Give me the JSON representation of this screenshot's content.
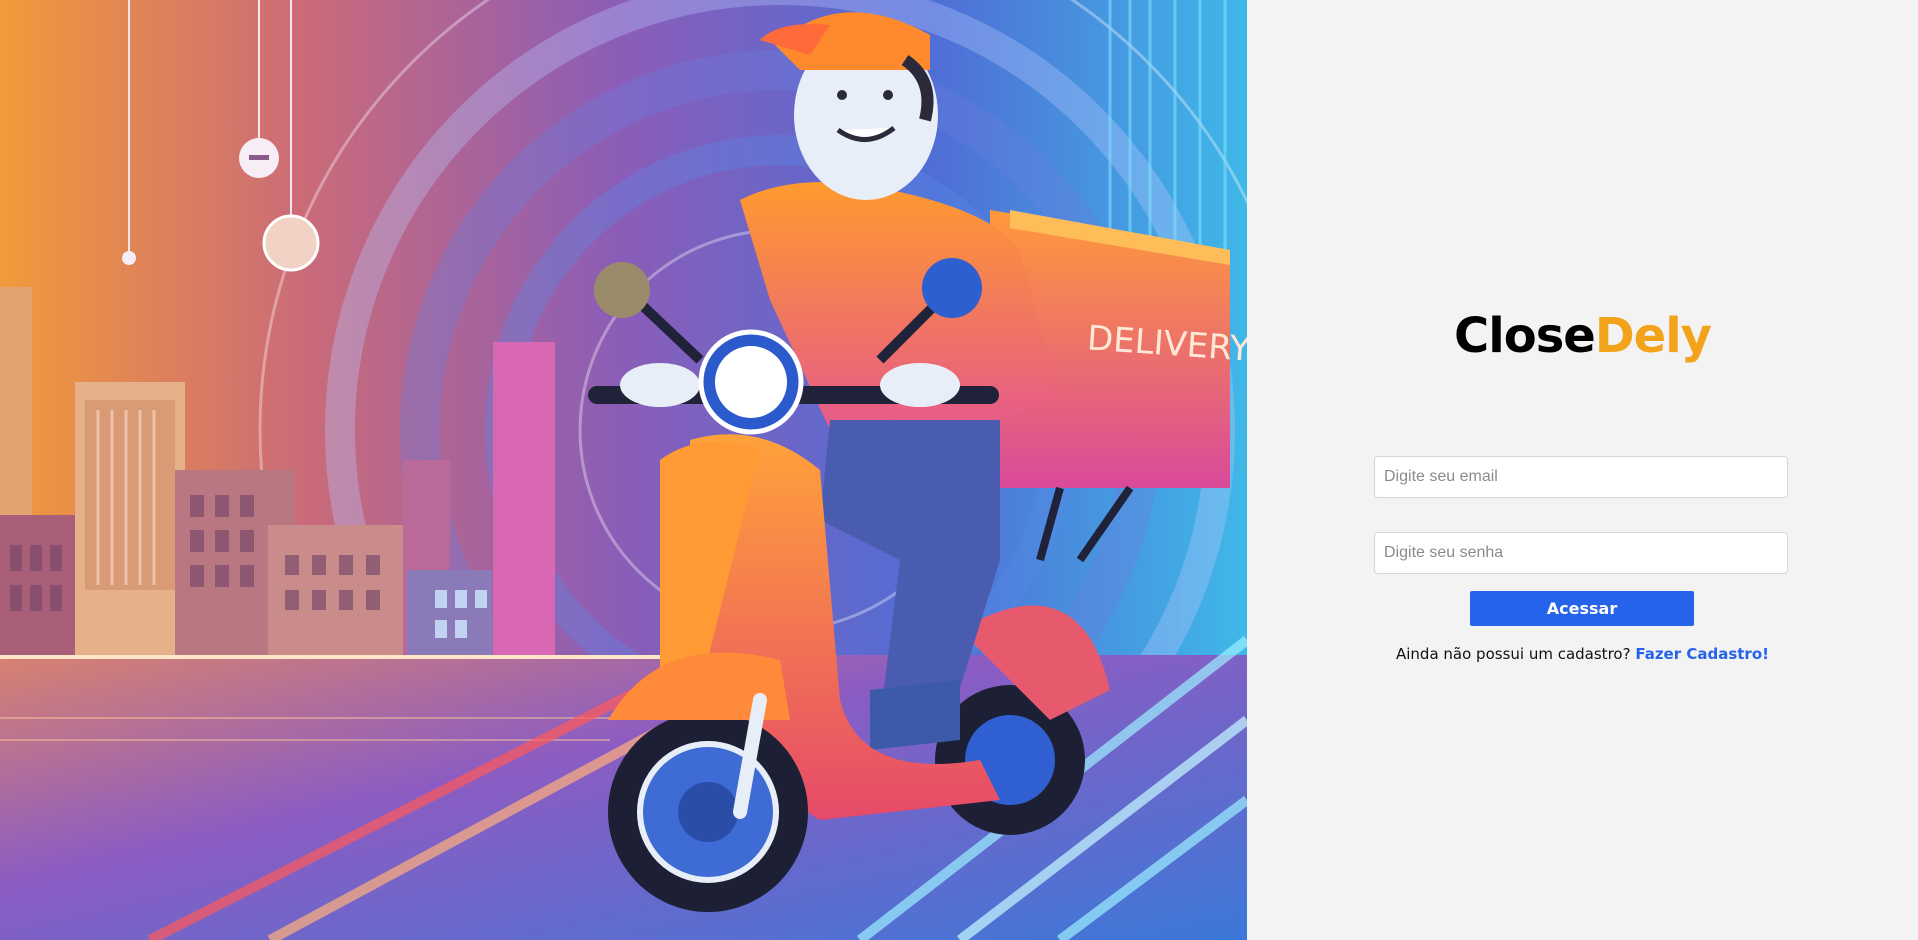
{
  "hero": {
    "box_text": "DELIVERY"
  },
  "brand": {
    "part1": "Close",
    "part2": "Dely"
  },
  "form": {
    "email_placeholder": "Digite seu email",
    "senha_placeholder": "Digite seu senha",
    "submit_label": "Acessar",
    "signup_prompt": "Ainda não possui um cadastro?",
    "signup_link": "Fazer Cadastro!"
  },
  "colors": {
    "brand_dark": "#000000",
    "brand_accent": "#f2a31b",
    "primary": "#2563eb",
    "panel_bg": "#f3f3f3"
  }
}
